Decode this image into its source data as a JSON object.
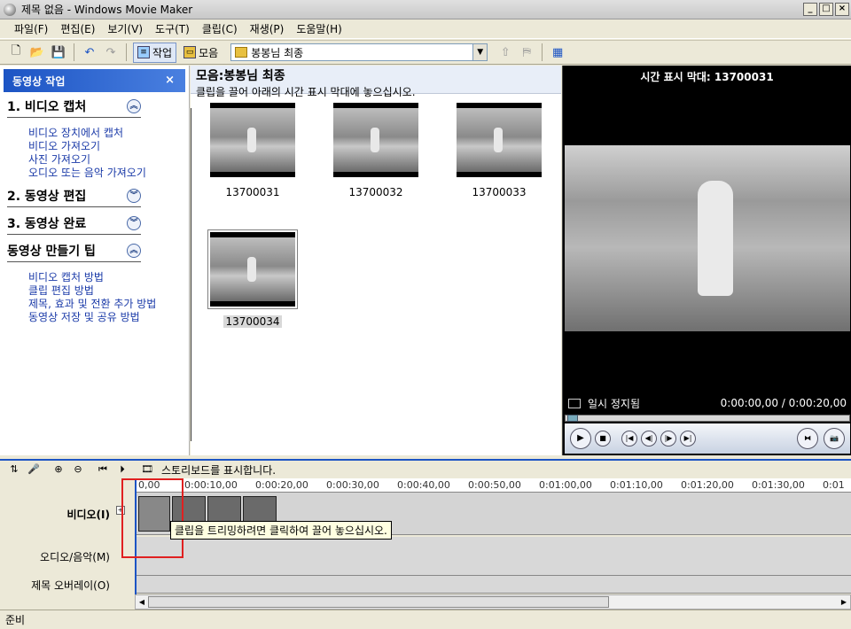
{
  "window": {
    "title": "제목 없음 - Windows Movie Maker"
  },
  "menu": [
    "파일(F)",
    "편집(E)",
    "보기(V)",
    "도구(T)",
    "클립(C)",
    "재생(P)",
    "도움말(H)"
  ],
  "toolbar": {
    "tasks_label": "작업",
    "collections_label": "모음",
    "collection_value": "봉봉님 최종"
  },
  "task_pane": {
    "header": "동영상 작업",
    "close": "×",
    "sections": [
      {
        "title": "1. 비디오 캡처",
        "expanded": true,
        "links": [
          "비디오 장치에서 캡처",
          "비디오 가져오기",
          "사진 가져오기",
          "오디오 또는 음악 가져오기"
        ]
      },
      {
        "title": "2. 동영상 편집",
        "expanded": false,
        "links": []
      },
      {
        "title": "3. 동영상 완료",
        "expanded": false,
        "links": []
      },
      {
        "title": "동영상 만들기 팁",
        "expanded": true,
        "links": [
          "비디오 캡처 방법",
          "클립 편집 방법",
          "제목, 효과 및 전환 추가 방법",
          "동영상 저장 및 공유 방법"
        ]
      }
    ]
  },
  "collection": {
    "title": "모음:봉봉님 최종",
    "hint": "클립을 끌어 아래의 시간 표시 막대에 놓으십시오.",
    "clips": [
      "13700031",
      "13700032",
      "13700033",
      "13700034"
    ]
  },
  "preview": {
    "title": "시간 표시 막대: 13700031",
    "status": "일시 정지됨",
    "time": "0:00:00,00 / 0:00:20,00"
  },
  "timeline": {
    "toolbar_text": "스토리보드를 표시합니다.",
    "ruler": [
      "0,00",
      "0:00:10,00",
      "0:00:20,00",
      "0:00:30,00",
      "0:00:40,00",
      "0:00:50,00",
      "0:01:00,00",
      "0:01:10,00",
      "0:01:20,00",
      "0:01:30,00",
      "0:01"
    ],
    "tracks": {
      "video": "비디오(I)",
      "audio": "오디오/음악(M)",
      "overlay": "제목 오버레이(O)"
    },
    "tooltip": "클립을 트리밍하려면 클릭하여 끌어 놓으십시오."
  },
  "status": "준비"
}
